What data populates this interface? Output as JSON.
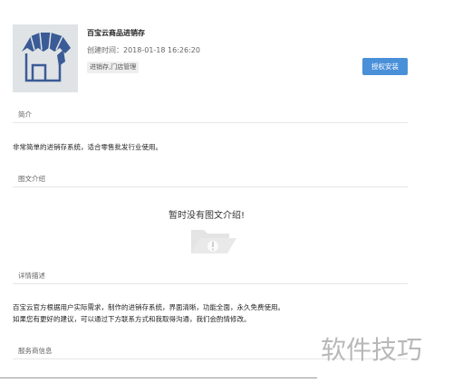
{
  "app": {
    "title": "百宝云商品进销存",
    "created": "创建时间：2018-01-18 16:26:20",
    "tag": "进销存,门店管理",
    "install_label": "授权安装",
    "icon": "store-icon"
  },
  "sections": {
    "intro": {
      "label": "简介",
      "text": "非常简单的进销存系统，适合零售批发行业使用。"
    },
    "media": {
      "label": "图文介绍",
      "empty_text": "暂时没有图文介绍!",
      "empty_icon": "empty-folder-icon"
    },
    "details": {
      "label": "详情描述",
      "line1": "百宝云官方根据用户实际需求，制作的进销存系统，界面清晰，功能全面，永久免费使用。",
      "line2": "如果您有更好的建议，可以通过下方联系方式和我取得沟通，我们会酌情修改。"
    },
    "provider": {
      "label": "服务商信息"
    }
  },
  "watermark": "软件技巧",
  "colors": {
    "accent": "#4a90d9",
    "icon_bg": "#dfe3e6",
    "icon_fg": "#3b5b96"
  }
}
